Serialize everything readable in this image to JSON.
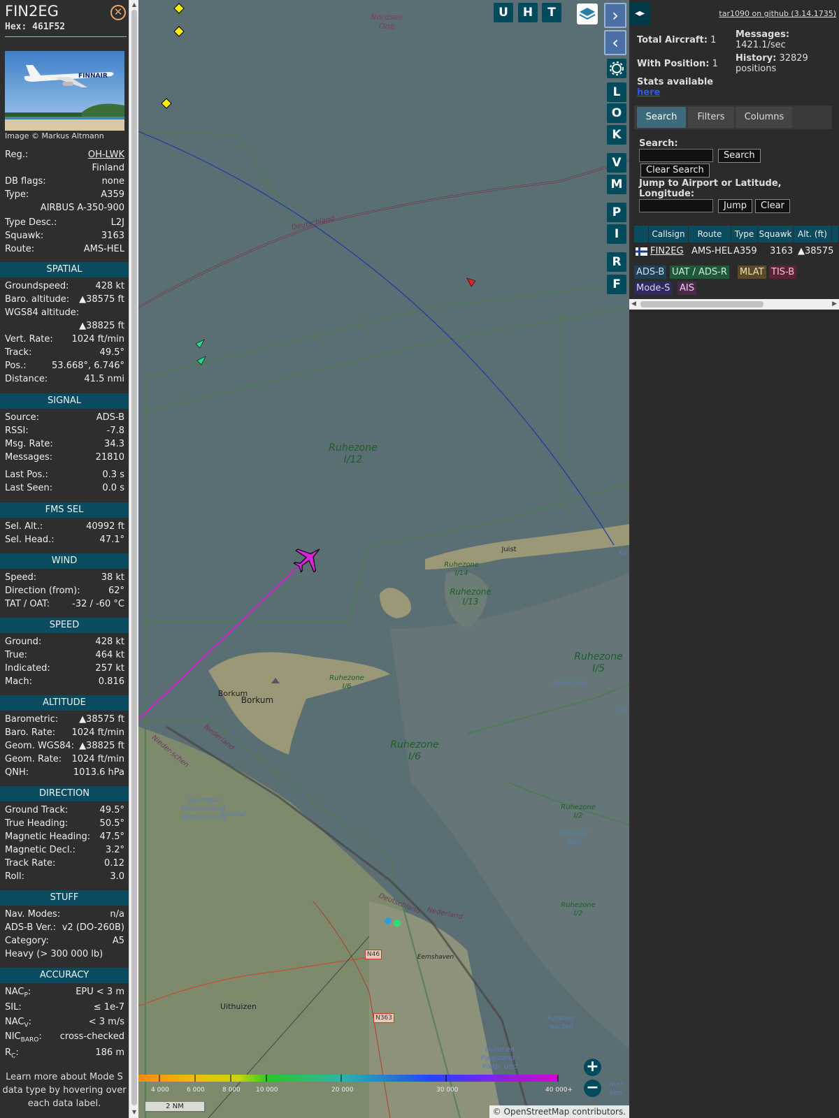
{
  "aircraft": {
    "callsign": "FIN2EG",
    "hex_label": "Hex:",
    "hex": "461F52",
    "image_credit": "Image © Markus Altmann"
  },
  "details": [
    {
      "k": "Reg.:",
      "v": "OH-LWK",
      "link": true
    },
    {
      "k": "",
      "v": "Finland"
    },
    {
      "k": "DB flags:",
      "v": "none"
    },
    {
      "k": "Type:",
      "v": "A359"
    },
    {
      "k": "",
      "v": "AIRBUS A-350-900"
    },
    {
      "k": "Type Desc.:",
      "v": "L2J"
    },
    {
      "k": "Squawk:",
      "v": "3163"
    },
    {
      "k": "Route:",
      "v": "AMS-HEL"
    }
  ],
  "sections": [
    {
      "title": "SPATIAL",
      "rows": [
        {
          "k": "Groundspeed:",
          "v": "428 kt"
        },
        {
          "k": "Baro. altitude:",
          "v": "▲38575 ft"
        },
        {
          "k": "WGS84 altitude:",
          "v": ""
        },
        {
          "k": "",
          "v": "▲38825 ft"
        },
        {
          "k": "Vert. Rate:",
          "v": "1024 ft/min"
        },
        {
          "k": "Track:",
          "v": "49.5°"
        },
        {
          "k": "Pos.:",
          "v": "53.668°, 6.746°"
        },
        {
          "k": "Distance:",
          "v": "41.5 nmi"
        }
      ]
    },
    {
      "title": "SIGNAL",
      "rows": [
        {
          "k": "Source:",
          "v": "ADS-B"
        },
        {
          "k": "RSSI:",
          "v": "-7.8"
        },
        {
          "k": "Msg. Rate:",
          "v": "34.3"
        },
        {
          "k": "Messages:",
          "v": "21810"
        },
        {
          "k": "Last Pos.:",
          "v": "0.3 s"
        },
        {
          "k": "Last Seen:",
          "v": "0.0 s"
        }
      ]
    },
    {
      "title": "FMS SEL",
      "rows": [
        {
          "k": "Sel. Alt.:",
          "v": "40992 ft"
        },
        {
          "k": "Sel. Head.:",
          "v": "47.1°"
        }
      ]
    },
    {
      "title": "WIND",
      "rows": [
        {
          "k": "Speed:",
          "v": "38 kt"
        },
        {
          "k": "Direction (from):",
          "v": "62°"
        },
        {
          "k": "TAT / OAT:",
          "v": "-32 / -60 °C"
        }
      ]
    },
    {
      "title": "SPEED",
      "rows": [
        {
          "k": "Ground:",
          "v": "428 kt"
        },
        {
          "k": "True:",
          "v": "464 kt"
        },
        {
          "k": "Indicated:",
          "v": "257 kt"
        },
        {
          "k": "Mach:",
          "v": "0.816"
        }
      ]
    },
    {
      "title": "ALTITUDE",
      "rows": [
        {
          "k": "Barometric:",
          "v": "▲38575 ft"
        },
        {
          "k": "Baro. Rate:",
          "v": "1024 ft/min"
        },
        {
          "k": "Geom. WGS84:",
          "v": "▲38825 ft"
        },
        {
          "k": "Geom. Rate:",
          "v": "1024 ft/min"
        },
        {
          "k": "QNH:",
          "v": "1013.6 hPa"
        }
      ]
    },
    {
      "title": "DIRECTION",
      "rows": [
        {
          "k": "Ground Track:",
          "v": "49.5°"
        },
        {
          "k": "True Heading:",
          "v": "50.5°"
        },
        {
          "k": "Magnetic Heading:",
          "v": "47.5°"
        },
        {
          "k": "Magnetic Decl.:",
          "v": "3.2°"
        },
        {
          "k": "Track Rate:",
          "v": "0.12"
        },
        {
          "k": "Roll:",
          "v": "3.0"
        }
      ]
    },
    {
      "title": "STUFF",
      "rows": [
        {
          "k": "Nav. Modes:",
          "v": "n/a"
        },
        {
          "k": "ADS-B Ver.:",
          "v": "v2 (DO-260B)"
        },
        {
          "k": "Category:",
          "v": "A5"
        },
        {
          "k": "Heavy (> 300 000 lb)",
          "v": ""
        }
      ]
    },
    {
      "title": "ACCURACY",
      "rows": [
        {
          "k": "NAC<sub>P</sub>:",
          "v": "EPU < 3 m",
          "html": true
        },
        {
          "k": "SIL:",
          "v": "≤ 1e-7"
        },
        {
          "k": "NAC<sub>V</sub>:",
          "v": "< 3 m/s",
          "html": true
        },
        {
          "k": "NIC<sub>BARO</sub>:",
          "v": "cross-checked",
          "html": true
        },
        {
          "k": "R<sub>C</sub>:",
          "v": "186 m",
          "html": true
        }
      ]
    }
  ],
  "learn_more": "Learn more about Mode S data type by hovering over each data label.",
  "map": {
    "buttons": [
      "U",
      "H",
      "T"
    ],
    "side_buttons": [
      "L",
      "O",
      "K",
      "V",
      "M",
      "P",
      "I",
      "R",
      "F"
    ],
    "labels": [
      {
        "text": "Nordsee One"
      },
      {
        "text": "Ruhezone I/12"
      },
      {
        "text": "Ruhezone I/14"
      },
      {
        "text": "Ruhezone I/13"
      },
      {
        "text": "Ruhezone I/5"
      },
      {
        "text": "Ruhezone I/6"
      },
      {
        "text": "Ruhezone I/6"
      },
      {
        "text": "Ruhezone I/2"
      },
      {
        "text": "Ruhezone I/2"
      },
      {
        "text": "Borkum"
      },
      {
        "text": "Borkum"
      },
      {
        "text": "Juist"
      },
      {
        "text": "Deutschland"
      },
      {
        "text": "Deutschland"
      },
      {
        "text": "Nederland"
      },
      {
        "text": "Nederland"
      },
      {
        "text": "Nieder-schen"
      },
      {
        "text": "Eemshaven"
      },
      {
        "text": "Uithuizen"
      },
      {
        "text": "Kopersand"
      },
      {
        "text": "Pilsumer Watt"
      },
      {
        "text": "Randzel"
      },
      {
        "text": "Sparregat Horsbornzand Horsbornzand"
      },
      {
        "text": "Rysumer Nacken"
      },
      {
        "text": "Hund en Paapzand / Paap- und"
      },
      {
        "text": "Ha"
      },
      {
        "text": "Ka"
      },
      {
        "text": "mer ken"
      }
    ],
    "roads": [
      "N46",
      "N363"
    ],
    "altitude_legend": [
      "4 000",
      "6 000",
      "8 000",
      "10 000",
      "20 000",
      "30 000",
      "40 000+"
    ],
    "scale": "2 NM",
    "attribution_prefix": "© ",
    "attribution_link": "OpenStreetMap",
    "attribution_suffix": " contributors.",
    "colors": {
      "track": "#cc22cc",
      "water": "#5b6e73",
      "land": "#8a8f72"
    }
  },
  "right": {
    "github": "tar1090 on github (3.14.1735)",
    "total_aircraft_label": "Total Aircraft:",
    "total_aircraft": "1",
    "with_position_label": "With Position:",
    "with_position": "1",
    "messages_label": "Messages:",
    "messages": "1421.1/sec",
    "history_label": "History:",
    "history": "32829 positions",
    "stats_label": "Stats available",
    "stats_link": "here",
    "tabs": [
      "Search",
      "Filters",
      "Columns"
    ],
    "search_label": "Search:",
    "search_btn": "Search",
    "clear_search_btn": "Clear Search",
    "jump_label": "Jump to Airport or Latitude, Longitude:",
    "jump_btn": "Jump",
    "clear_btn": "Clear",
    "columns": [
      "Callsign",
      "Route",
      "Type",
      "Squawk",
      "Alt. (ft)"
    ],
    "row": {
      "callsign": "FIN2EG",
      "route": "AMS-HEL",
      "type": "A359",
      "squawk": "3163",
      "alt": "▲38575"
    },
    "sources": [
      {
        "label": "ADS-B",
        "bg": "#1f3f56",
        "fg": "#c8e0f0"
      },
      {
        "label": "UAT / ADS-R",
        "bg": "#1e5a3a",
        "fg": "#cfeecf"
      },
      {
        "label": "MLAT",
        "bg": "#5a4a2a",
        "fg": "#f0e0b0"
      },
      {
        "label": "TIS-B",
        "bg": "#5a2336",
        "fg": "#f5c6d6"
      },
      {
        "label": "Mode-S",
        "bg": "#2e2a5e",
        "fg": "#d6d2f6"
      },
      {
        "label": "AIS",
        "bg": "#4a2a4a",
        "fg": "#f0d0f0"
      }
    ]
  }
}
